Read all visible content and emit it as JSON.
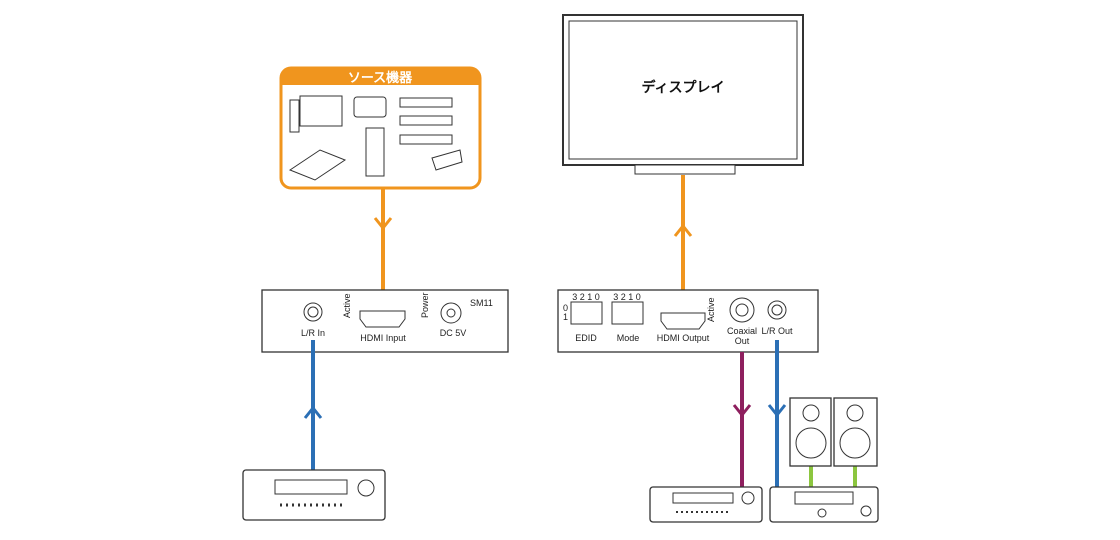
{
  "source": {
    "title": "ソース機器"
  },
  "display": {
    "label": "ディスプレイ"
  },
  "transmitter": {
    "model": "SM11",
    "lr_in": "L/R In",
    "hdmi_input": "HDMI Input",
    "dc": "DC 5V",
    "active": "Active",
    "power": "Power"
  },
  "receiver": {
    "dip_numbers": "3 2 1 0",
    "dip_row0": "0",
    "dip_row1": "1",
    "edid": "EDID",
    "mode": "Mode",
    "hdmi_output": "HDMI Output",
    "active": "Active",
    "coaxial_1": "Coaxial",
    "coaxial_2": "Out",
    "lr_out": "L/R Out"
  },
  "colors": {
    "hdmi": "#f0951e",
    "analog": "#2b6fb5",
    "coaxial": "#8e1f5e",
    "speaker": "#8cc63f"
  }
}
